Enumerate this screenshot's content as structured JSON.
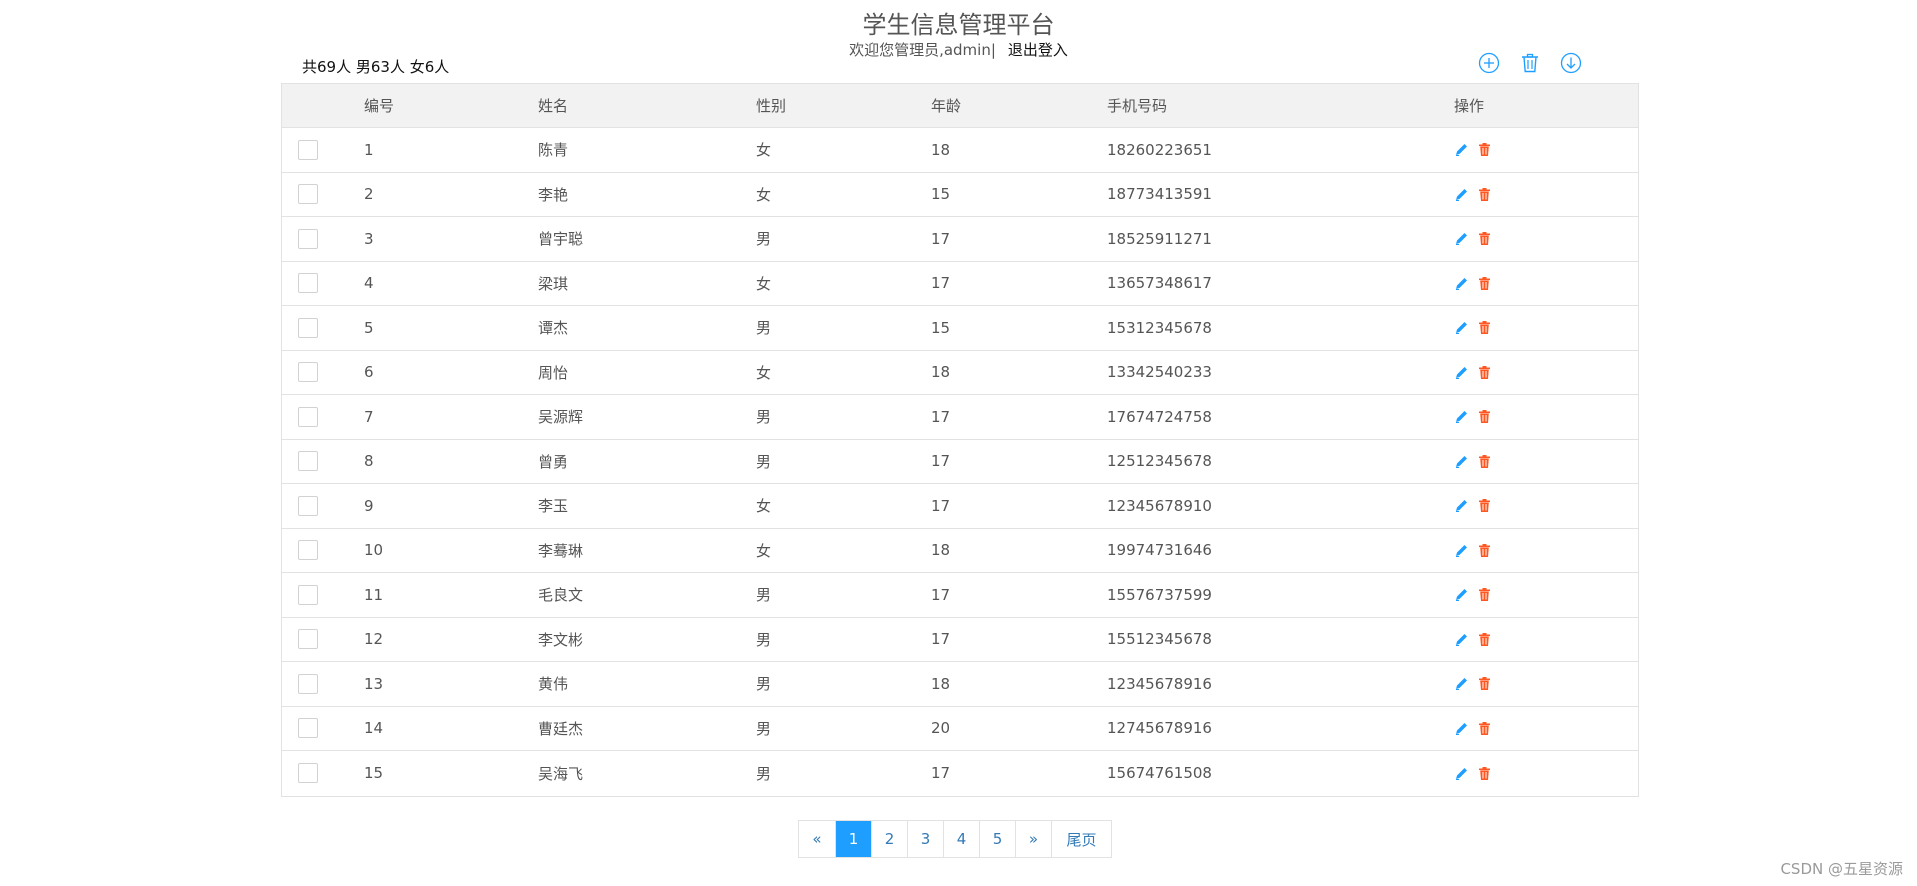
{
  "header": {
    "title": "学生信息管理平台",
    "welcome": "欢迎您管理员,admin|",
    "logout": "退出登入"
  },
  "stats": "共69人 男63人 女6人",
  "toolbar": {
    "icons": [
      "add-icon",
      "trash-icon",
      "download-icon"
    ],
    "accent": "#1e9fff"
  },
  "table": {
    "columns": [
      "编号",
      "姓名",
      "性别",
      "年龄",
      "手机号码",
      "操作"
    ],
    "rows": [
      {
        "id": "1",
        "name": "陈青",
        "sex": "女",
        "age": "18",
        "phone": "18260223651"
      },
      {
        "id": "2",
        "name": "李艳",
        "sex": "女",
        "age": "15",
        "phone": "18773413591"
      },
      {
        "id": "3",
        "name": "曾宇聪",
        "sex": "男",
        "age": "17",
        "phone": "18525911271"
      },
      {
        "id": "4",
        "name": "梁琪",
        "sex": "女",
        "age": "17",
        "phone": "13657348617"
      },
      {
        "id": "5",
        "name": "谭杰",
        "sex": "男",
        "age": "15",
        "phone": "15312345678"
      },
      {
        "id": "6",
        "name": "周怡",
        "sex": "女",
        "age": "18",
        "phone": "13342540233"
      },
      {
        "id": "7",
        "name": "吴源辉",
        "sex": "男",
        "age": "17",
        "phone": "17674724758"
      },
      {
        "id": "8",
        "name": "曾勇",
        "sex": "男",
        "age": "17",
        "phone": "12512345678"
      },
      {
        "id": "9",
        "name": "李玉",
        "sex": "女",
        "age": "17",
        "phone": "12345678910"
      },
      {
        "id": "10",
        "name": "李蓦琳",
        "sex": "女",
        "age": "18",
        "phone": "19974731646"
      },
      {
        "id": "11",
        "name": "毛良文",
        "sex": "男",
        "age": "17",
        "phone": "15576737599"
      },
      {
        "id": "12",
        "name": "李文彬",
        "sex": "男",
        "age": "17",
        "phone": "15512345678"
      },
      {
        "id": "13",
        "name": "黄伟",
        "sex": "男",
        "age": "18",
        "phone": "12345678916"
      },
      {
        "id": "14",
        "name": "曹廷杰",
        "sex": "男",
        "age": "20",
        "phone": "12745678916"
      },
      {
        "id": "15",
        "name": "吴海飞",
        "sex": "男",
        "age": "17",
        "phone": "15674761508"
      }
    ],
    "edit_icon": "pencil-icon",
    "delete_icon": "trash-icon",
    "edit_color": "#1e9fff",
    "delete_color": "#ff5722"
  },
  "pagination": {
    "prev": "«",
    "pages": [
      "1",
      "2",
      "3",
      "4",
      "5"
    ],
    "active": "1",
    "next": "»",
    "last": "尾页"
  },
  "watermark": "CSDN @五星资源"
}
